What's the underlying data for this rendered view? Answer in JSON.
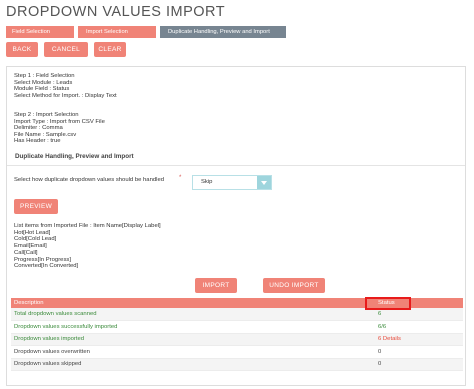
{
  "page": {
    "title": "DROPDOWN VALUES IMPORT"
  },
  "wizard": {
    "steps": [
      {
        "label": "Field Selection",
        "state": "done"
      },
      {
        "label": "Import Selection",
        "state": "done"
      },
      {
        "label": "Duplicate Handling, Preview and Import",
        "state": "current"
      }
    ]
  },
  "actions": {
    "back": "BACK",
    "cancel": "CANCEL",
    "clear": "CLEAR"
  },
  "step1": {
    "heading": "Step 1 : Field Selection",
    "module": "Select Module : Leads",
    "field": "Module Field : Status",
    "method": "Select Method for Import. : Display Text"
  },
  "step2": {
    "heading": "Step 2 : Import Selection",
    "type": "Import Type : Import from CSV File",
    "delimiter": "Delimiter : Comma",
    "file": "File Name : Sample.csv",
    "header": "Has Header : true"
  },
  "duplicate": {
    "section_title": "Duplicate Handling, Preview and Import",
    "label": "Select how duplicate dropdown values should be handled",
    "required_mark": "*",
    "selected": "Skip"
  },
  "preview_button": "PREVIEW",
  "list": {
    "heading": "List items from Imported File : Item Name[Display Label]",
    "items": [
      "Hot[Hot Lead]",
      "Cold[Cold Lead]",
      "Email[Email]",
      "Call[Call]",
      "Progress[In Progress]",
      "Converted[In Converted]"
    ]
  },
  "import_button": "IMPORT",
  "undo_button": "UNDO IMPORT",
  "results": {
    "headers": {
      "description": "Description",
      "status": "Status"
    },
    "rows": [
      {
        "description": "Total dropdown values scanned",
        "status": "6"
      },
      {
        "description": "Dropdown values successfully imported",
        "status": "6/6"
      },
      {
        "description": "Dropdown values imported",
        "status": "6 Details"
      },
      {
        "description": "Dropdown values overwritten",
        "status": "0"
      },
      {
        "description": "Dropdown values skipped",
        "status": "0"
      }
    ]
  },
  "colors": {
    "accent": "#f08377",
    "current_step": "#778591",
    "select_arrow": "#9ed5dd",
    "highlight": "#e81b1b"
  }
}
